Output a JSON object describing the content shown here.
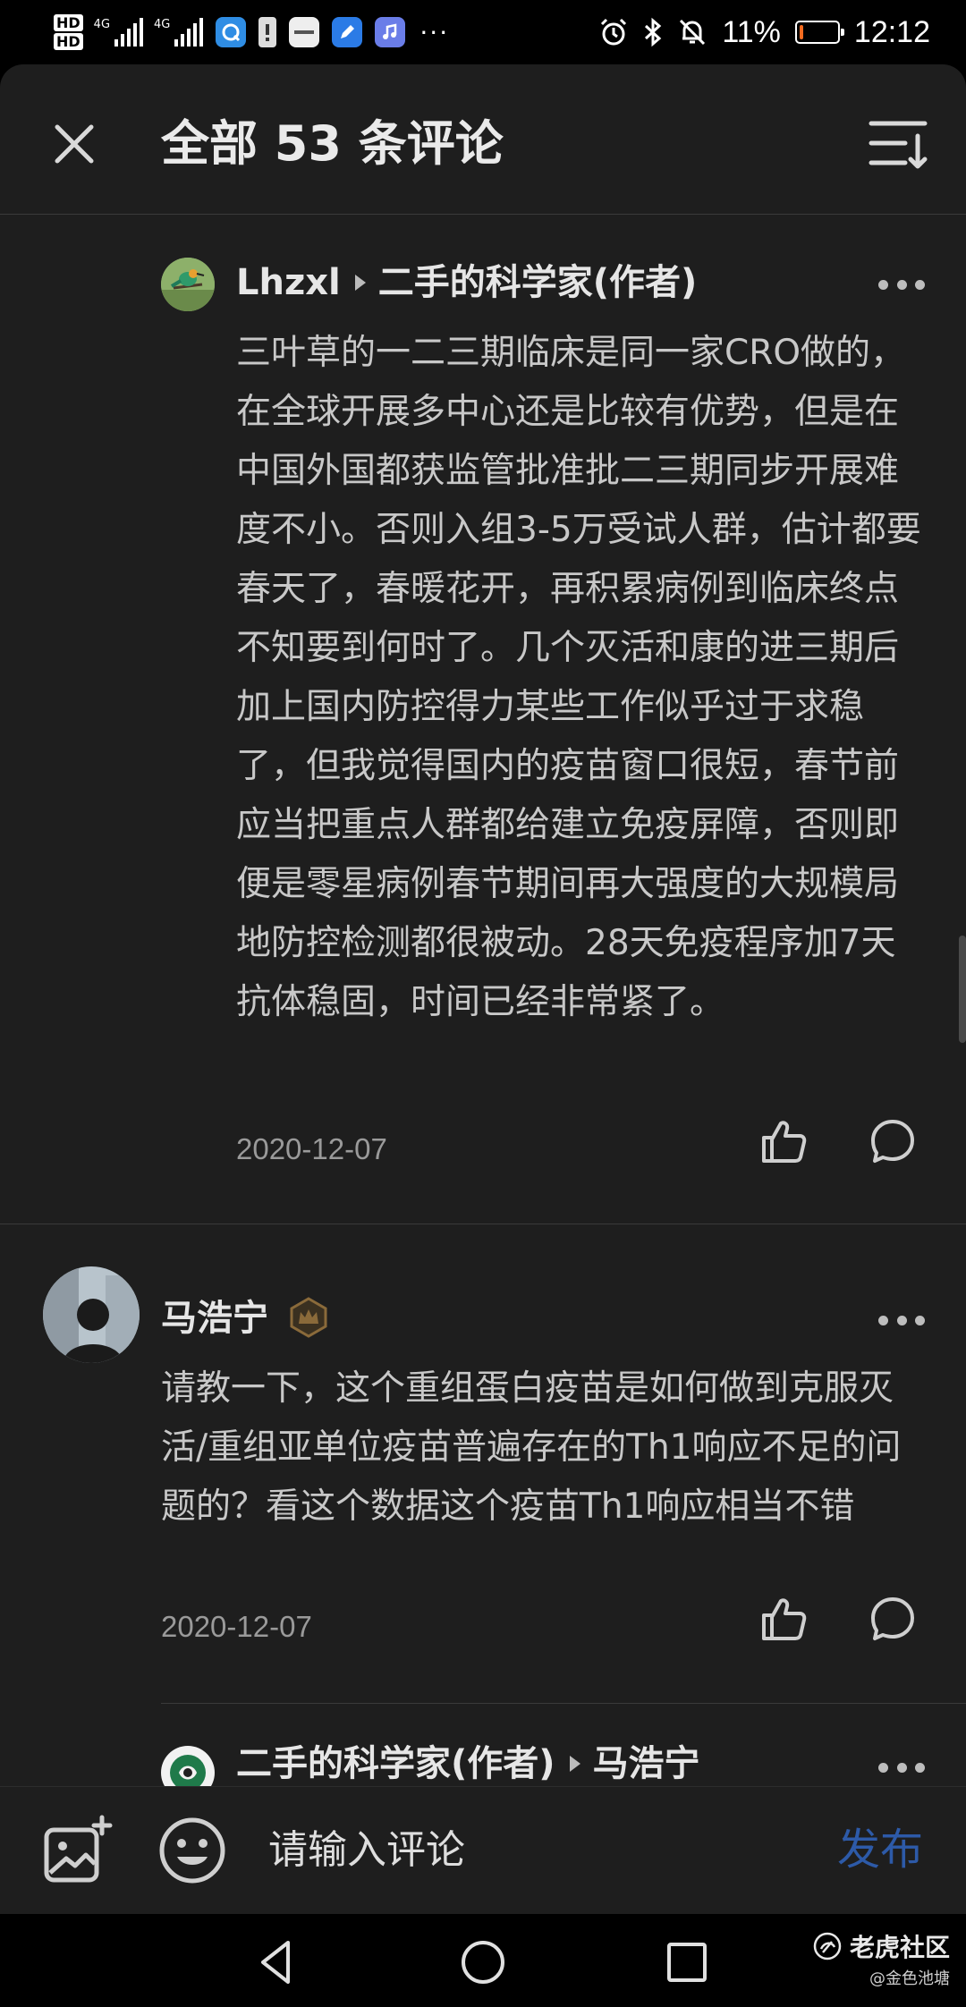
{
  "status_bar": {
    "hd_top": "HD",
    "hd_bottom": "HD",
    "net1": "4G",
    "net2": "4G",
    "battery_percent": "11%",
    "battery_level": 0.11,
    "time": "12:12",
    "more": "···",
    "icons": [
      "alarm-icon",
      "bluetooth-icon",
      "mute-icon"
    ],
    "battery_color": "#f56b1f"
  },
  "header": {
    "title": "全部 53 条评论"
  },
  "comments": [
    {
      "author": "Lhzxl",
      "reply_to": "二手的科学家(作者)",
      "text": "三叶草的一二三期临床是同一家CRO做的，在全球开展多中心还是比较有优势，但是在中国外国都获监管批准批二三期同步开展难度不小。否则入组3-5万受试人群，估计都要春天了，春暖花开，再积累病例到临床终点不知要到何时了。几个灭活和康的进三期后加上国内防控得力某些工作似乎过于求稳了，但我觉得国内的疫苗窗口很短，春节前应当把重点人群都给建立免疫屏障，否则即便是零星病例春节期间再大强度的大规模局地防控检测都很被动。28天免疫程序加7天抗体稳固，时间已经非常紧了。",
      "date": "2020-12-07"
    },
    {
      "author": "马浩宁",
      "text": "请教一下，这个重组蛋白疫苗是如何做到克服灭活/重组亚单位疫苗普遍存在的Th1响应不足的问题的？看这个数据这个疫苗Th1响应相当不错",
      "date": "2020-12-07"
    },
    {
      "author": "二手的科学家(作者)",
      "reply_to": "马浩宁"
    }
  ],
  "input_bar": {
    "placeholder": "请输入评论",
    "publish_label": "发布"
  },
  "watermark": {
    "brand": "老虎社区",
    "handle": "@金色池塘"
  },
  "colors": {
    "sheet_bg": "#1e1e1e",
    "publish_blue": "#2d5aa8",
    "badge_gold": "#8a6a3a"
  }
}
